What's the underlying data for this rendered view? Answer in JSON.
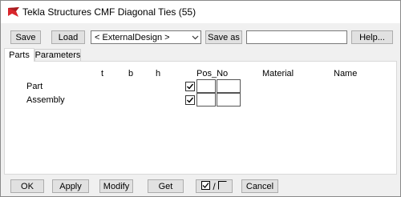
{
  "window": {
    "title": "Tekla Structures  CMF Diagonal Ties (55)",
    "accent_color": "#d9262c"
  },
  "toolbar": {
    "save_label": "Save",
    "load_label": "Load",
    "preset_selected": "< ExternalDesign >",
    "save_as_label": "Save as",
    "save_as_value": "",
    "help_label": "Help..."
  },
  "tabs": [
    {
      "label": "Parts",
      "active": true
    },
    {
      "label": "Parameters",
      "active": false
    }
  ],
  "parts_tab": {
    "columns": {
      "t": "t",
      "b": "b",
      "h": "h",
      "pos_no": "Pos_No",
      "material": "Material",
      "name": "Name"
    },
    "rows": [
      {
        "label": "Part",
        "checked": true,
        "prefix": "",
        "start_no": ""
      },
      {
        "label": "Assembly",
        "checked": true,
        "prefix": "",
        "start_no": ""
      }
    ]
  },
  "bottom": {
    "ok_label": "OK",
    "apply_label": "Apply",
    "modify_label": "Modify",
    "get_label": "Get",
    "toggle_slash": "/",
    "cancel_label": "Cancel"
  }
}
